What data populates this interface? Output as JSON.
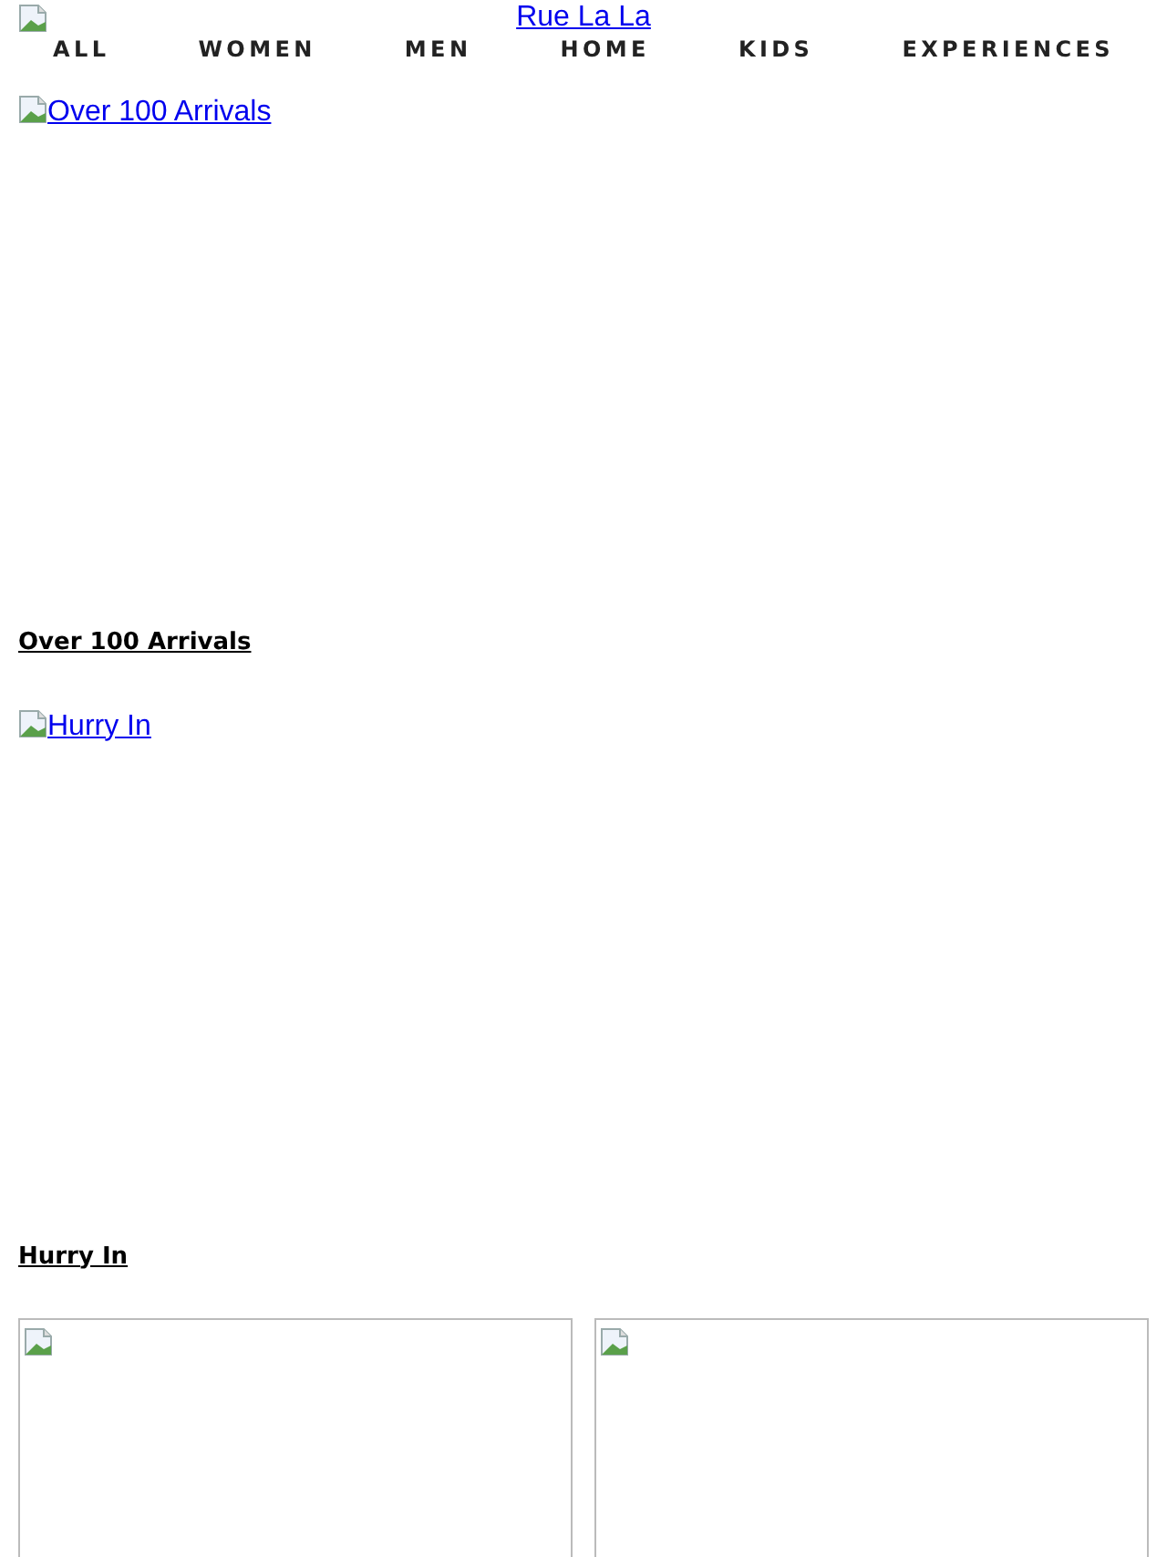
{
  "logo": {
    "alt": "Rue La La"
  },
  "nav": [
    {
      "label": "ALL"
    },
    {
      "label": "WOMEN"
    },
    {
      "label": "MEN"
    },
    {
      "label": "HOME"
    },
    {
      "label": "KIDS"
    },
    {
      "label": "EXPERIENCES"
    }
  ],
  "banners": [
    {
      "alt": "Over 100 Arrivals",
      "caption": "Over 100 Arrivals"
    },
    {
      "alt": "Hurry In",
      "caption": "Hurry In"
    }
  ],
  "tiles": [
    {
      "kind": "broken-image"
    },
    {
      "kind": "broken-image"
    }
  ]
}
